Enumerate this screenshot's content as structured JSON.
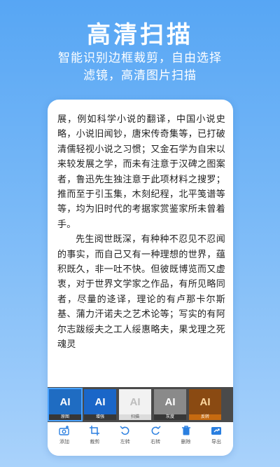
{
  "header": {
    "title": "高清扫描",
    "subtitle_line1": "智能识别边框裁剪，自由选择",
    "subtitle_line2": "滤镜，高清图片扫描"
  },
  "document": {
    "paragraph1": "展，例如科学小说的翻译，中国小说史略，小说旧闻钞，唐宋传奇集等，已打破清儒轻视小说之习惯；又金石学为自宋以来较发展之学，而未有注意于汉碑之图案者，鲁迅先生独注意于此项材料之搜罗；推而至于引玉集，木刻纪程，北平笺谱等等，均为旧时代的考据家赏鉴家所未曾着手。",
    "paragraph2": "先生阅世既深，有种种不忍见不忍闻的事实，而自己又有一种理想的世界，蕴积既久，非一吐不快。但彼既博览而又虚衷，对于世界文学家之作品，有所见略同者，尽量的迻译，理论的有卢那卡尔斯基、蒲力汗诺夫之艺术论等；写实的有阿尔志跋绥夫之工人绥惠略夫，果戈理之死魂灵"
  },
  "filters": [
    {
      "thumb": "AI",
      "label": "原图"
    },
    {
      "thumb": "AI",
      "label": "增强"
    },
    {
      "thumb": "AI",
      "label": "扫描"
    },
    {
      "thumb": "AI",
      "label": "灰度"
    },
    {
      "thumb": "AI",
      "label": "反转"
    }
  ],
  "toolbar": [
    {
      "label": "添加",
      "icon": "camera-add-icon"
    },
    {
      "label": "裁剪",
      "icon": "crop-icon"
    },
    {
      "label": "左转",
      "icon": "rotate-left-icon"
    },
    {
      "label": "右转",
      "icon": "rotate-right-icon"
    },
    {
      "label": "删除",
      "icon": "trash-icon"
    },
    {
      "label": "导出",
      "icon": "export-icon"
    }
  ],
  "colors": {
    "background_top": "#57a6f4",
    "background_bottom": "#a9d2fb",
    "accent": "#2a7fe0",
    "filter_bar": "#4a4a4a"
  }
}
